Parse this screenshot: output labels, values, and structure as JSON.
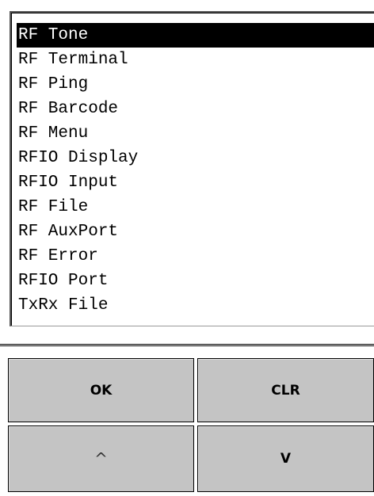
{
  "list": {
    "selected_index": 0,
    "items": [
      {
        "label": "RF Tone"
      },
      {
        "label": "RF Terminal"
      },
      {
        "label": "RF Ping"
      },
      {
        "label": "RF Barcode"
      },
      {
        "label": "RF Menu"
      },
      {
        "label": "RFIO Display"
      },
      {
        "label": "RFIO Input"
      },
      {
        "label": "RF File"
      },
      {
        "label": "RF AuxPort"
      },
      {
        "label": "RF Error"
      },
      {
        "label": "RFIO Port"
      },
      {
        "label": "TxRx File"
      }
    ]
  },
  "buttons": {
    "ok": "OK",
    "clr": "CLR",
    "up": "^",
    "down": "V"
  },
  "colors": {
    "selection_bg": "#000000",
    "selection_fg": "#ffffff",
    "button_bg": "#c4c4c4"
  }
}
